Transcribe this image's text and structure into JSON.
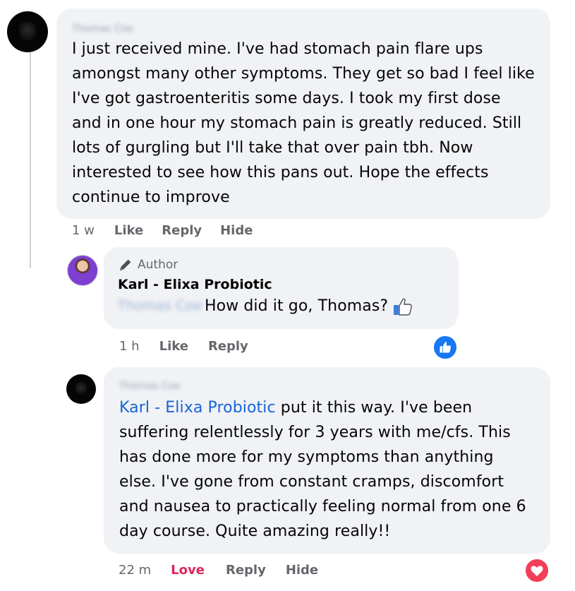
{
  "comment1": {
    "author_blurred": "Thomas Coe",
    "text": "I just received mine. I've had stomach pain flare ups amongst many other symptoms. They get so bad I feel like I've got gastroenteritis some days. I took my first dose and in one hour my stomach pain is greatly reduced. Still lots of gurgling but I'll take that over pain tbh. Now interested to see how this pans out. Hope the effects continue to improve",
    "time": "1 w",
    "like": "Like",
    "reply": "Reply",
    "hide": "Hide"
  },
  "reply1": {
    "badge": "Author",
    "author": "Karl - Elixa Probiotic",
    "mention_blurred": "Thomas Coe",
    "text": "How did it go, Thomas?",
    "time": "1 h",
    "like": "Like",
    "reply": "Reply",
    "reaction_icon": "like-reaction-icon",
    "reaction_color": "#1877f2"
  },
  "reply2": {
    "author_blurred": "Thomas Coe",
    "mention": "Karl - Elixa Probiotic",
    "text": " put it this way. I've been suffering relentlessly for 3 years with me/cfs. This has done more for my symptoms than anything else. I've gone from constant cramps, discomfort and nausea to practically feeling normal from one 6 day course. Quite amazing really!!",
    "time": "22 m",
    "love": "Love",
    "reply": "Reply",
    "hide": "Hide",
    "reaction_icon": "love-reaction-icon",
    "reaction_color": "#e0245e"
  },
  "colors": {
    "bubble": "#f0f2f5",
    "meta": "#65676b",
    "mention": "#1664d9",
    "love": "#e0245e"
  }
}
